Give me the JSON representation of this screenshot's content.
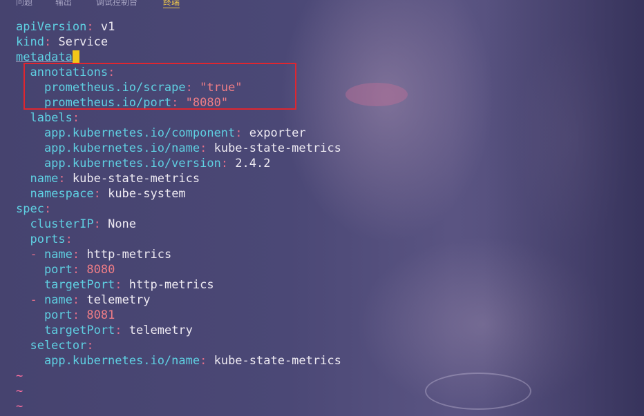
{
  "panel_tabs": {
    "problems": "问题",
    "output": "输出",
    "debug_console": "调试控制台",
    "terminal": "终端"
  },
  "editor": {
    "lines": [
      {
        "key": "apiVersion",
        "sep": ":",
        "value": " v1"
      },
      {
        "key": "kind",
        "sep": ":",
        "value": " Service"
      },
      {
        "key": "metadata",
        "sep": ""
      },
      {
        "key": "  annotations",
        "sep": ":"
      },
      {
        "key": "    prometheus.io/scrape",
        "sep": ":",
        "value": " \"true\""
      },
      {
        "key": "    prometheus.io/port",
        "sep": ":",
        "value": " \"8080\""
      },
      {
        "key": "  labels",
        "sep": ":"
      },
      {
        "key": "    app.kubernetes.io/component",
        "sep": ":",
        "value": " exporter"
      },
      {
        "key": "    app.kubernetes.io/name",
        "sep": ":",
        "value": " kube-state-metrics"
      },
      {
        "key": "    app.kubernetes.io/version",
        "sep": ":",
        "value": " 2.4.2"
      },
      {
        "key": "  name",
        "sep": ":",
        "value": " kube-state-metrics"
      },
      {
        "key": "  namespace",
        "sep": ":",
        "value": " kube-system"
      },
      {
        "key": "spec",
        "sep": ":"
      },
      {
        "key": "  clusterIP",
        "sep": ":",
        "value": " None"
      },
      {
        "key": "  ports",
        "sep": ":"
      },
      {
        "dash": "  - ",
        "key": "name",
        "sep": ":",
        "value": " http-metrics"
      },
      {
        "key": "    port",
        "sep": ":",
        "value": " 8080"
      },
      {
        "key": "    targetPort",
        "sep": ":",
        "value": " http-metrics"
      },
      {
        "dash": "  - ",
        "key": "name",
        "sep": ":",
        "value": " telemetry"
      },
      {
        "key": "    port",
        "sep": ":",
        "value": " 8081"
      },
      {
        "key": "    targetPort",
        "sep": ":",
        "value": " telemetry"
      },
      {
        "key": "  selector",
        "sep": ":"
      },
      {
        "key": "    app.kubernetes.io/name",
        "sep": ":",
        "value": " kube-state-metrics"
      }
    ],
    "tilde": "~"
  },
  "colors": {
    "key": "#5fd0e2",
    "punct": "#e26f8a",
    "string": "#ef7d86",
    "text": "#eeeaf2",
    "cursor": "#f2c619",
    "highlight_box": "#e0262f",
    "active_tab": "#f0c94a"
  }
}
